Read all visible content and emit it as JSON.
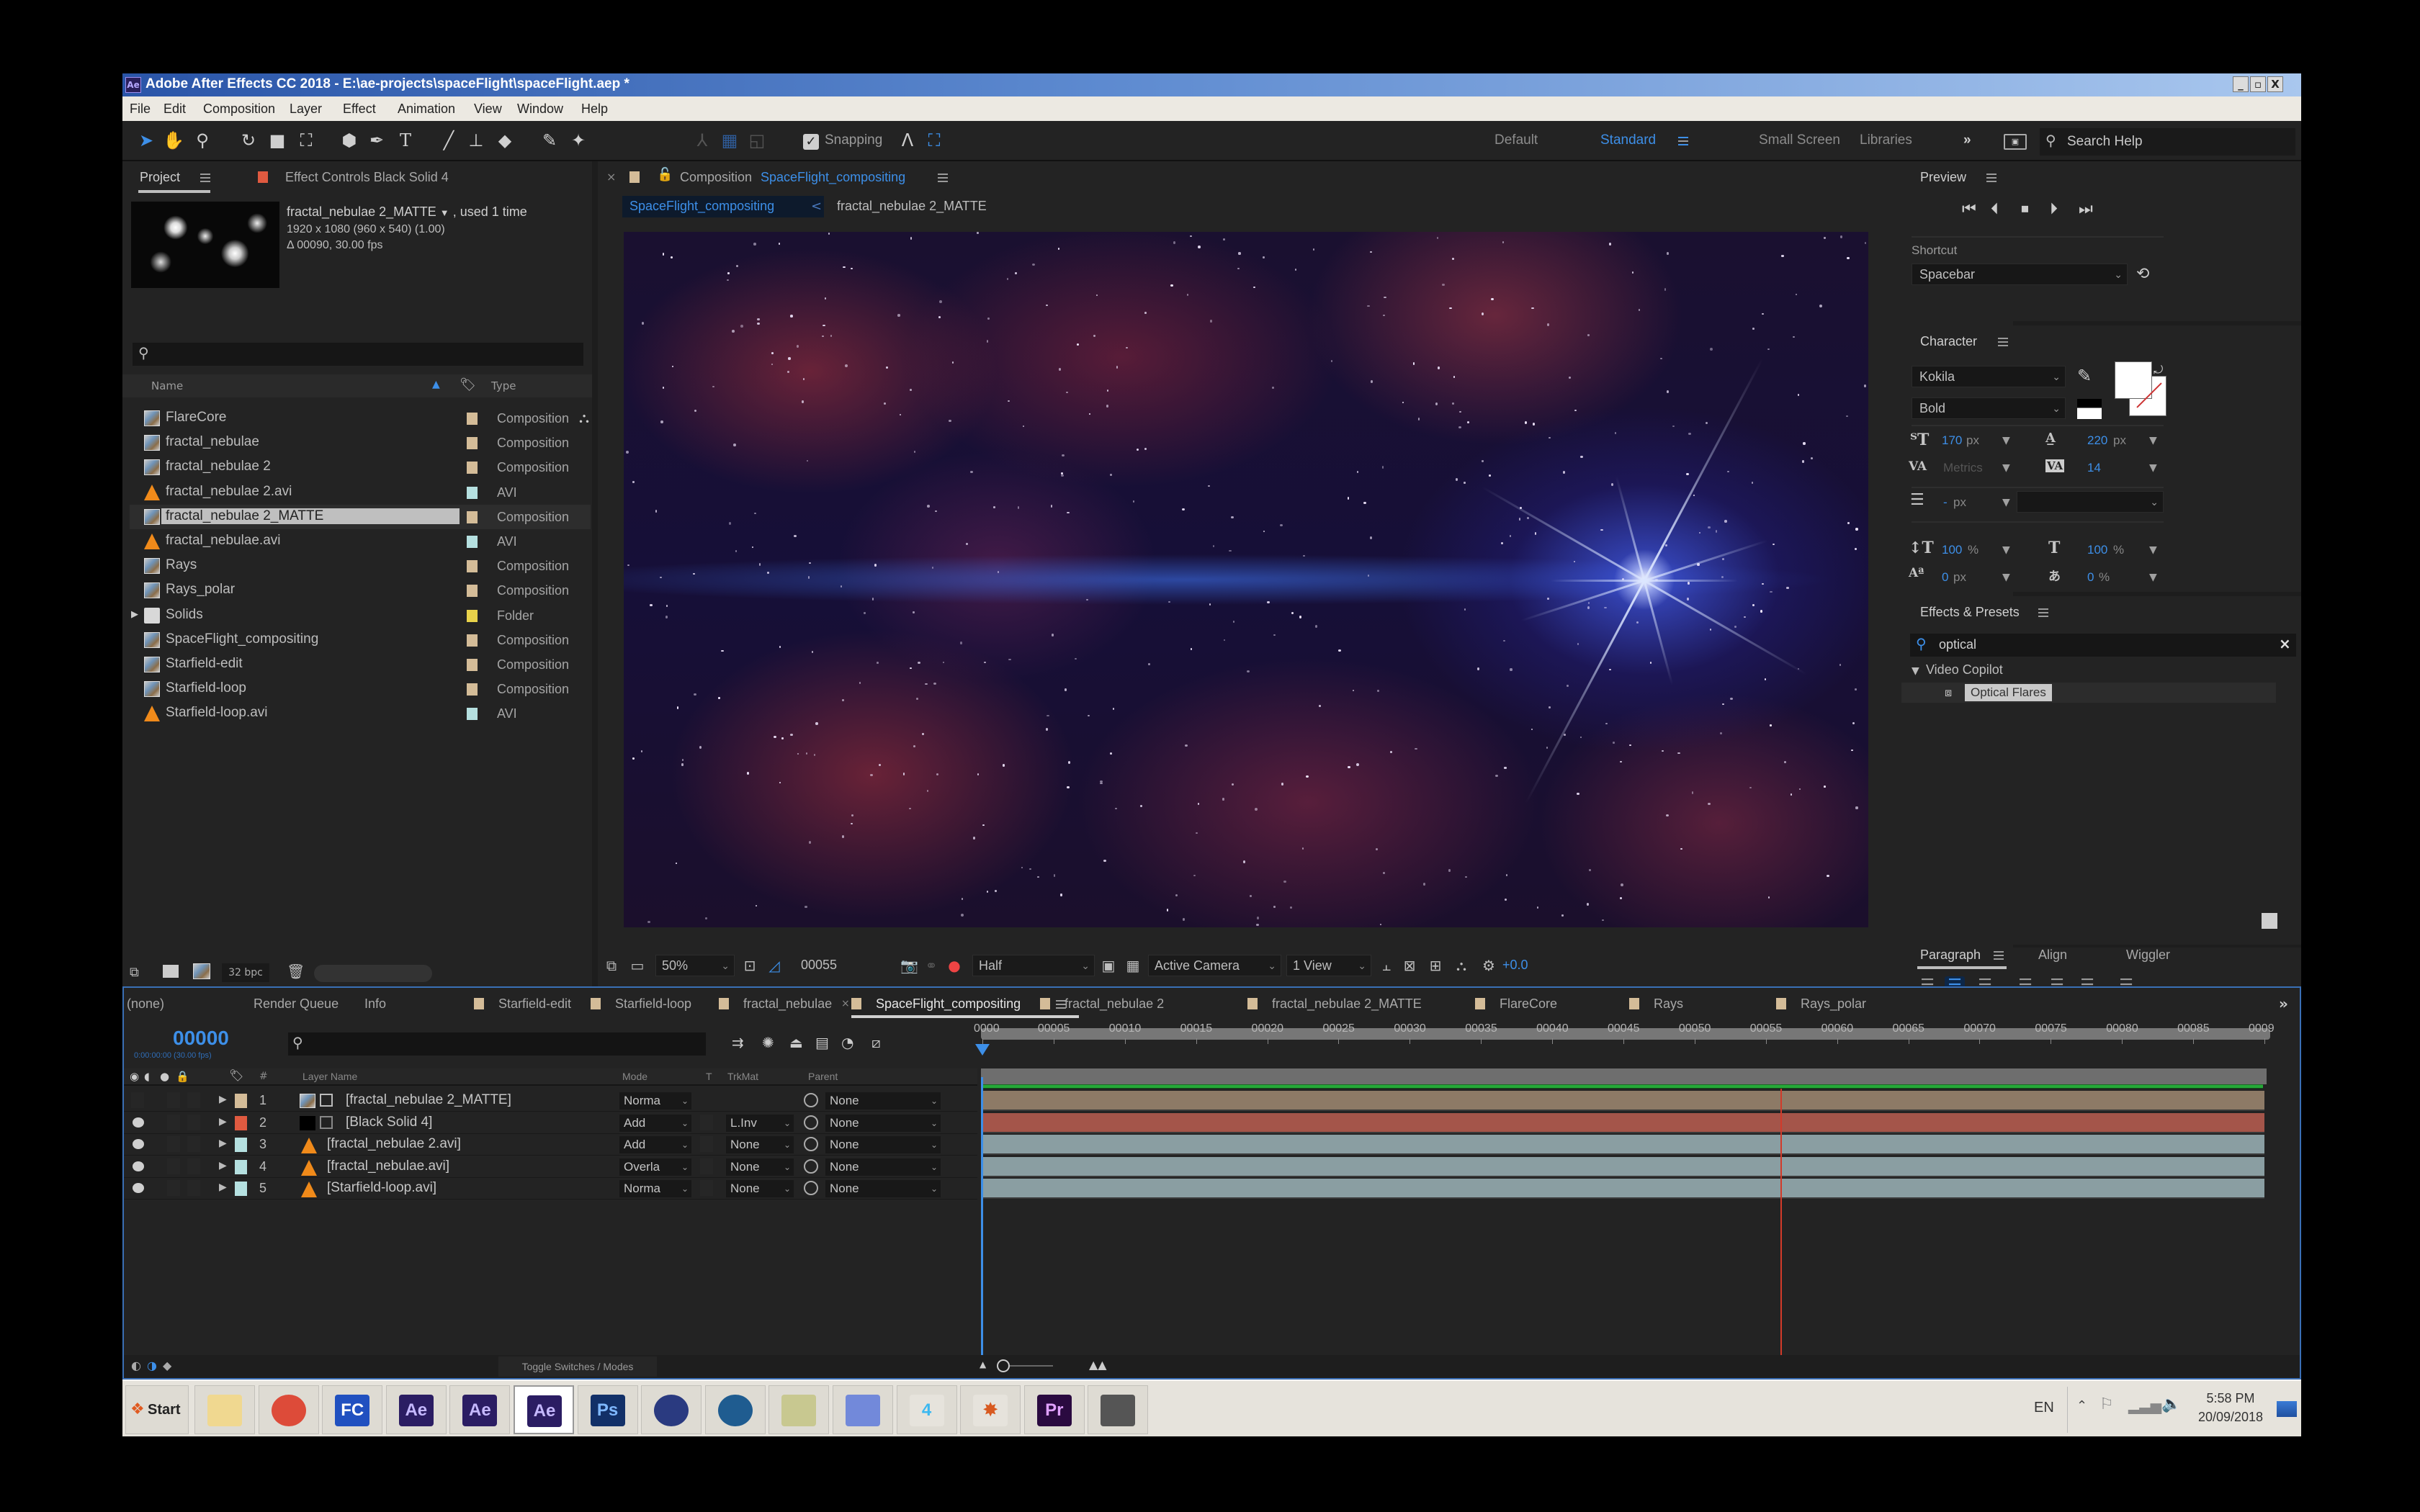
{
  "window": {
    "title": "Adobe After Effects CC 2018 - E:\\ae-projects\\spaceFlight\\spaceFlight.aep *",
    "app_icon": "Ae",
    "controls": [
      "_",
      "▫",
      "X"
    ]
  },
  "menu": [
    "File",
    "Edit",
    "Composition",
    "Layer",
    "Effect",
    "Animation",
    "View",
    "Window",
    "Help"
  ],
  "toolbar": {
    "snapping_label": "Snapping",
    "snapping_checked": true,
    "workspaces": [
      "Default",
      "Standard",
      "Small Screen",
      "Libraries"
    ],
    "active_workspace": "Standard",
    "overflow": "»",
    "search_help_placeholder": "Search Help"
  },
  "project_panel": {
    "tab_project": "Project",
    "tab_effect_controls": "Effect Controls Black Solid 4",
    "preview": {
      "name": "fractal_nebulae 2_MATTE",
      "used": ", used 1 time",
      "dimensions": "1920 x 1080  (960 x 540) (1.00)",
      "duration": "Δ 00090, 30.00 fps"
    },
    "search_placeholder": "",
    "columns": {
      "name": "Name",
      "type": "Type"
    },
    "items": [
      {
        "name": "FlareCore",
        "type": "Composition",
        "kind": "comp",
        "label_color": "#d4bc98"
      },
      {
        "name": "fractal_nebulae",
        "type": "Composition",
        "kind": "comp",
        "label_color": "#d4bc98"
      },
      {
        "name": "fractal_nebulae 2",
        "type": "Composition",
        "kind": "comp",
        "label_color": "#d4bc98"
      },
      {
        "name": "fractal_nebulae 2.avi",
        "type": "AVI",
        "kind": "avi",
        "label_color": "#b5e0e0"
      },
      {
        "name": "fractal_nebulae 2_MATTE",
        "type": "Composition",
        "kind": "comp",
        "label_color": "#d4bc98",
        "selected": true
      },
      {
        "name": "fractal_nebulae.avi",
        "type": "AVI",
        "kind": "avi",
        "label_color": "#b5e0e0"
      },
      {
        "name": "Rays",
        "type": "Composition",
        "kind": "comp",
        "label_color": "#d4bc98"
      },
      {
        "name": "Rays_polar",
        "type": "Composition",
        "kind": "comp",
        "label_color": "#d4bc98"
      },
      {
        "name": "Solids",
        "type": "Folder",
        "kind": "folder",
        "label_color": "#e8d24a"
      },
      {
        "name": "SpaceFlight_compositing",
        "type": "Composition",
        "kind": "comp",
        "label_color": "#d4bc98"
      },
      {
        "name": "Starfield-edit",
        "type": "Composition",
        "kind": "comp",
        "label_color": "#d4bc98"
      },
      {
        "name": "Starfield-loop",
        "type": "Composition",
        "kind": "comp",
        "label_color": "#d4bc98"
      },
      {
        "name": "Starfield-loop.avi",
        "type": "AVI",
        "kind": "avi",
        "label_color": "#b5e0e0"
      }
    ],
    "bit_depth": "32 bpc"
  },
  "composition_panel": {
    "tab_prefix": "Composition",
    "tab_comp_name": "SpaceFlight_compositing",
    "breadcrumb_active": "SpaceFlight_compositing",
    "breadcrumb_sep": "<",
    "breadcrumb_next": "fractal_nebulae 2_MATTE",
    "zoom": "50%",
    "current_frame": "00055",
    "resolution": "Half",
    "camera": "Active Camera",
    "views": "1 View",
    "exposure": "+0.0"
  },
  "preview_panel": {
    "title": "Preview",
    "shortcut_label": "Shortcut",
    "shortcut_value": "Spacebar"
  },
  "character_panel": {
    "title": "Character",
    "font": "Kokila",
    "style": "Bold",
    "font_size": "170",
    "font_size_unit": "px",
    "leading": "220",
    "leading_unit": "px",
    "kerning": "Metrics",
    "tracking": "14",
    "stroke_width": "-",
    "stroke_unit": "px",
    "vertical_scale": "100",
    "horizontal_scale": "100",
    "percent": "%",
    "baseline_shift": "0",
    "baseline_unit": "px",
    "tsume": "0",
    "fill_color": "#ffffff",
    "stroke_color": "#ffffff"
  },
  "effects_panel": {
    "title": "Effects & Presets",
    "search_value": "optical",
    "group": "Video Copilot",
    "result": "Optical Flares"
  },
  "paragraph_panel": {
    "tabs": [
      "Paragraph",
      "Align",
      "Wiggler"
    ],
    "active_tab": "Paragraph",
    "active_align_index": 1
  },
  "timeline": {
    "tabs": [
      {
        "label": "(none)",
        "swatch": null
      },
      {
        "label": "Render Queue",
        "swatch": null
      },
      {
        "label": "Info",
        "swatch": null
      },
      {
        "label": "Starfield-edit",
        "swatch": "#d4bc98"
      },
      {
        "label": "Starfield-loop",
        "swatch": "#d4bc98"
      },
      {
        "label": "fractal_nebulae",
        "swatch": "#d4bc98"
      },
      {
        "label": "SpaceFlight_compositing",
        "swatch": "#d4bc98",
        "active": true
      },
      {
        "label": "fractal_nebulae 2",
        "swatch": "#d4bc98"
      },
      {
        "label": "fractal_nebulae 2_MATTE",
        "swatch": "#d4bc98"
      },
      {
        "label": "FlareCore",
        "swatch": "#d4bc98"
      },
      {
        "label": "Rays",
        "swatch": "#d4bc98"
      },
      {
        "label": "Rays_polar",
        "swatch": "#d4bc98"
      }
    ],
    "overflow": "»",
    "timecode": "00000",
    "timecode_sub": "0:00:00:00 (30.00 fps)",
    "ruler_ticks": [
      "0000",
      "00005",
      "00010",
      "00015",
      "00020",
      "00025",
      "00030",
      "00035",
      "00040",
      "00045",
      "00050",
      "00055",
      "00060",
      "00065",
      "00070",
      "00075",
      "00080",
      "00085",
      "0009"
    ],
    "total_frames": 90,
    "current_time_frame": 0,
    "marker_frame": 56,
    "columns": {
      "layer_name": "Layer Name",
      "mode": "Mode",
      "t": "T",
      "trkmat": "TrkMat",
      "parent": "Parent",
      "num": "#"
    },
    "layers": [
      {
        "num": "1",
        "name": "[fractal_nebulae 2_MATTE]",
        "kind": "comp",
        "label_color": "#d4bc98",
        "visible": false,
        "mode": "Norma",
        "trkmat": "",
        "parent": "None",
        "bar_color": "#8d7a66"
      },
      {
        "num": "2",
        "name": "[Black Solid 4]",
        "kind": "solid",
        "label_color": "#e05a40",
        "visible": true,
        "mode": "Add",
        "trkmat": "L.Inv",
        "parent": "None",
        "bar_color": "#a4554a"
      },
      {
        "num": "3",
        "name": "[fractal_nebulae 2.avi]",
        "kind": "avi",
        "label_color": "#b5e0e0",
        "visible": true,
        "mode": "Add",
        "trkmat": "None",
        "parent": "None",
        "bar_color": "#8a9ea2"
      },
      {
        "num": "4",
        "name": "[fractal_nebulae.avi]",
        "kind": "avi",
        "label_color": "#b5e0e0",
        "visible": true,
        "mode": "Overla",
        "trkmat": "None",
        "parent": "None",
        "bar_color": "#8a9ea2"
      },
      {
        "num": "5",
        "name": "[Starfield-loop.avi]",
        "kind": "avi",
        "label_color": "#b5e0e0",
        "visible": true,
        "mode": "Norma",
        "trkmat": "None",
        "parent": "None",
        "bar_color": "#8a9ea2"
      }
    ],
    "toggle_label": "Toggle Switches / Modes"
  },
  "taskbar": {
    "start_label": "Start",
    "apps": [
      {
        "name": "file-explorer",
        "glyph": "",
        "bg": "#f0d890",
        "fg": "#333"
      },
      {
        "name": "chrome",
        "glyph": "",
        "bg": "#dd4b39",
        "fg": "#fff"
      },
      {
        "name": "fc",
        "glyph": "FC",
        "bg": "#2050c0",
        "fg": "#fff"
      },
      {
        "name": "after-effects-1",
        "glyph": "Ae",
        "bg": "#2b1d63",
        "fg": "#c5b8ff"
      },
      {
        "name": "after-effects-2",
        "glyph": "Ae",
        "bg": "#2b1d63",
        "fg": "#c5b8ff"
      },
      {
        "name": "after-effects-3",
        "glyph": "Ae",
        "bg": "#2b1d63",
        "fg": "#c5b8ff",
        "active": true
      },
      {
        "name": "photoshop",
        "glyph": "Ps",
        "bg": "#123068",
        "fg": "#7fb8ff"
      },
      {
        "name": "cinema4d",
        "glyph": "",
        "bg": "#2a3a80",
        "fg": "#fff"
      },
      {
        "name": "teamspeak",
        "glyph": "",
        "bg": "#1f5c90",
        "fg": "#fff"
      },
      {
        "name": "notes",
        "glyph": "",
        "bg": "#c8c890",
        "fg": "#333"
      },
      {
        "name": "discord",
        "glyph": "",
        "bg": "#7289da",
        "fg": "#fff"
      },
      {
        "name": "app-4",
        "glyph": "4",
        "bg": "#e6e3dc",
        "fg": "#3cb8f0"
      },
      {
        "name": "splatter",
        "glyph": "✸",
        "bg": "#e6e3dc",
        "fg": "#d85a20"
      },
      {
        "name": "premiere",
        "glyph": "Pr",
        "bg": "#2a0a40",
        "fg": "#e0a0ff"
      },
      {
        "name": "camera-tool",
        "glyph": "",
        "bg": "#555",
        "fg": "#fff"
      }
    ],
    "language": "EN",
    "time": "5:58 PM",
    "date": "20/09/2018"
  }
}
